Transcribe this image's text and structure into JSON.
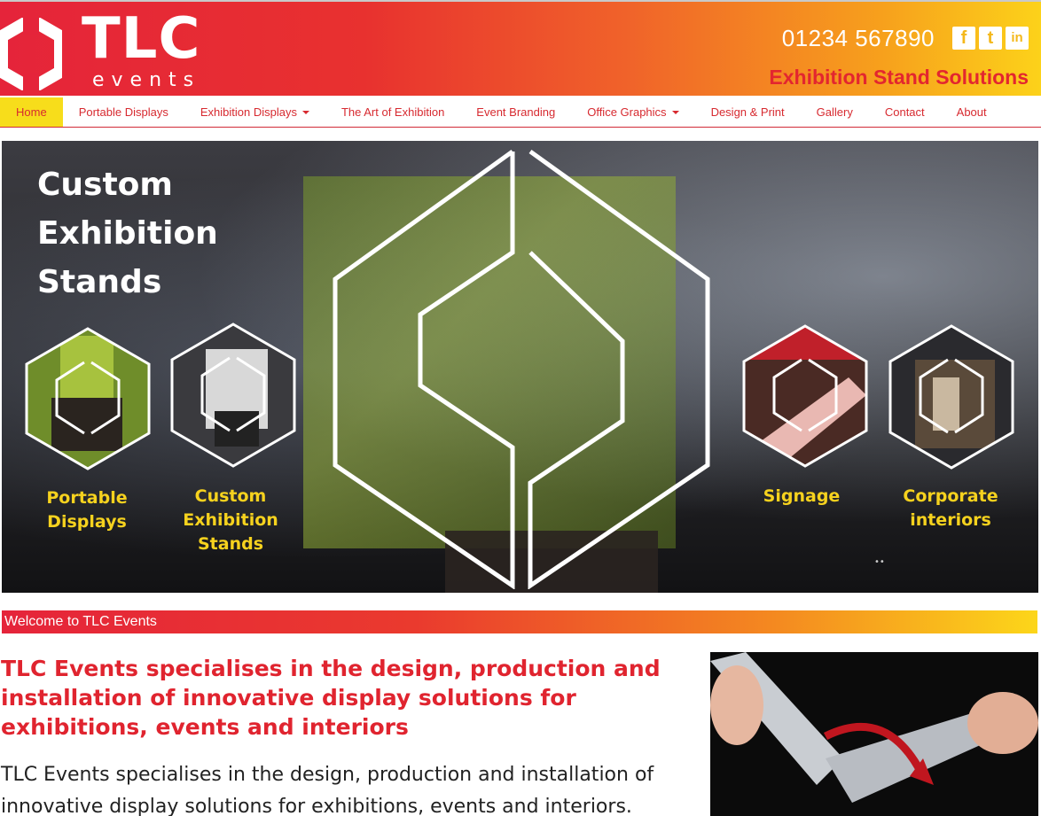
{
  "header": {
    "logo_title": "TLC",
    "logo_subtitle": "events",
    "phone": "01234 567890",
    "tagline": "Exhibition Stand Solutions",
    "social": [
      {
        "icon": "facebook-icon",
        "glyph": "f"
      },
      {
        "icon": "twitter-icon",
        "glyph": "t"
      },
      {
        "icon": "linkedin-icon",
        "glyph": "in"
      }
    ],
    "colors": {
      "gradient_start": "#e5243a",
      "gradient_end": "#fcd21a",
      "accent_red": "#e3262f",
      "accent_yellow": "#f6d21e"
    }
  },
  "nav": {
    "items": [
      {
        "label": "Home",
        "active": true,
        "dropdown": false
      },
      {
        "label": "Portable Displays",
        "active": false,
        "dropdown": false
      },
      {
        "label": "Exhibition Displays",
        "active": false,
        "dropdown": true
      },
      {
        "label": "The Art of Exhibition",
        "active": false,
        "dropdown": false
      },
      {
        "label": "Event Branding",
        "active": false,
        "dropdown": false
      },
      {
        "label": "Office Graphics",
        "active": false,
        "dropdown": true
      },
      {
        "label": "Design & Print",
        "active": false,
        "dropdown": false
      },
      {
        "label": "Gallery",
        "active": false,
        "dropdown": false
      },
      {
        "label": "Contact",
        "active": false,
        "dropdown": false
      },
      {
        "label": "About",
        "active": false,
        "dropdown": false
      }
    ]
  },
  "hero": {
    "title_lines": [
      "Custom",
      "Exhibition",
      "Stands"
    ],
    "tiles": [
      {
        "lines": [
          "Portable",
          "Displays"
        ]
      },
      {
        "lines": [
          "Custom",
          "Exhibition",
          "Stands"
        ]
      },
      {
        "lines": [
          "Signage"
        ]
      },
      {
        "lines": [
          "Corporate",
          "interiors"
        ]
      }
    ]
  },
  "welcome": {
    "bar_text": "Welcome to TLC Events",
    "heading": "TLC Events specialises in the design, production and installation of innovative display solutions for exhibitions, events and interiors",
    "body": "TLC Events specialises in the design, production and installation of innovative display solutions for exhibitions, events and interiors."
  }
}
